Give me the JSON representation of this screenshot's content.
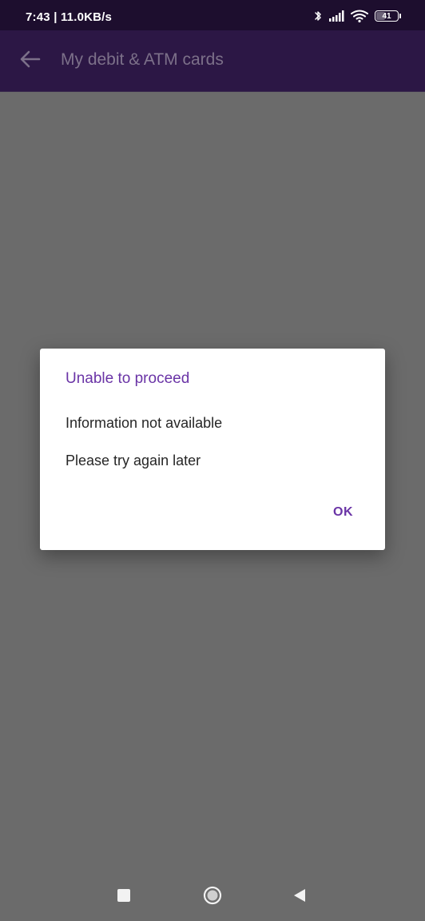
{
  "status_bar": {
    "time": "7:43 | 11.0KB/s",
    "battery_level": "41",
    "icons": [
      "bluetooth-icon",
      "signal-icon",
      "wifi-icon",
      "battery-icon"
    ]
  },
  "app_bar": {
    "title": "My debit & ATM cards",
    "back_icon": "arrow-back-icon"
  },
  "dialog": {
    "title": "Unable to proceed",
    "message_line1": "Information not available",
    "message_line2": "Please try again later",
    "ok_label": "OK"
  },
  "nav_bar": {
    "icons": [
      "recents-square-icon",
      "home-circle-icon",
      "back-triangle-icon"
    ]
  },
  "colors": {
    "status_bar_bg": "#1d0e2e",
    "app_bar_bg": "#2c1745",
    "scrim": "#6b6b6b",
    "accent": "#6a34a6",
    "dialog_text": "#262626"
  }
}
